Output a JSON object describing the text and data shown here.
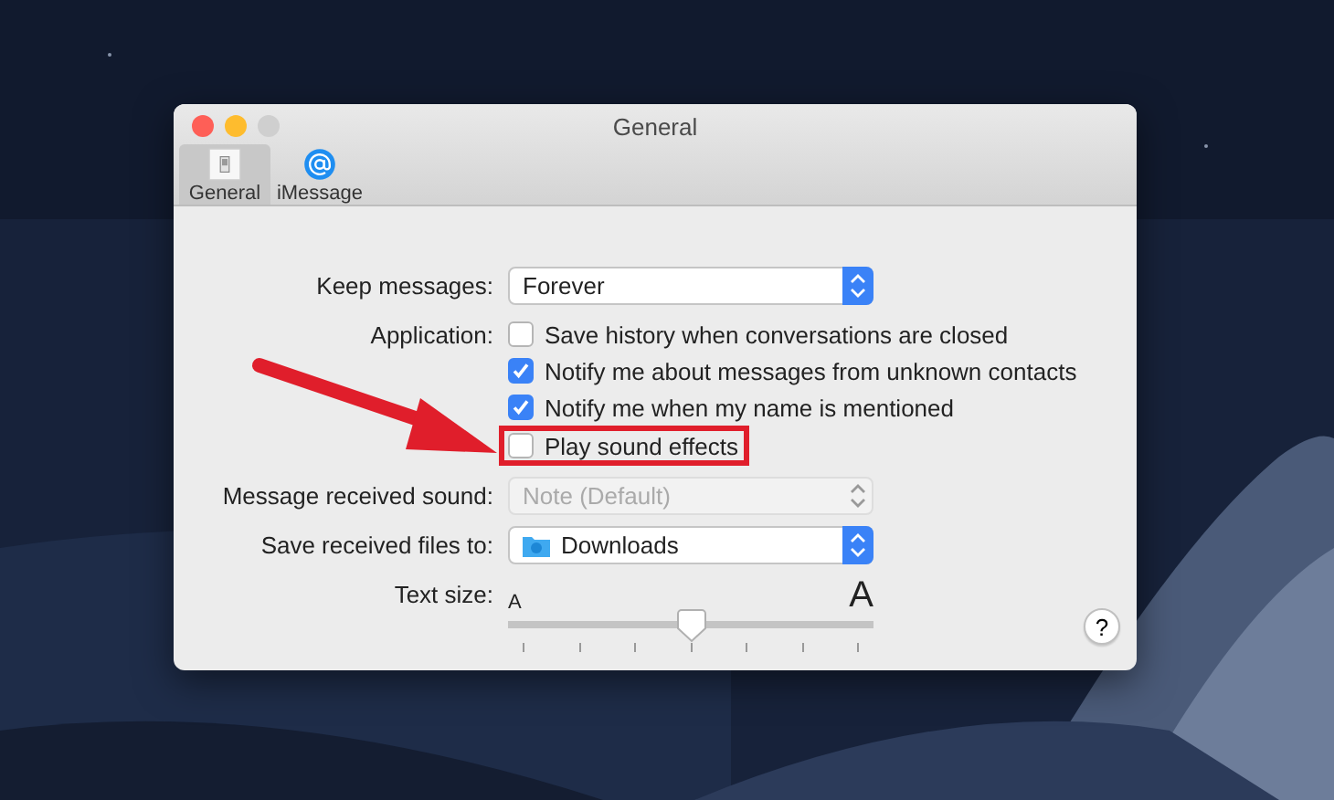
{
  "window": {
    "title": "General"
  },
  "tabs": [
    {
      "label": "General",
      "selected": true,
      "kind": "general"
    },
    {
      "label": "iMessage",
      "selected": false,
      "kind": "imessage"
    }
  ],
  "settings": [
    {
      "kind": "select",
      "label": "Keep messages:",
      "value": "Forever",
      "disabled": false
    },
    {
      "kind": "checkboxes",
      "label": "Application:",
      "options": [
        {
          "label": "Save history when conversations are closed",
          "checked": false,
          "highlighted": false
        },
        {
          "label": "Notify me about messages from unknown contacts",
          "checked": true,
          "highlighted": false
        },
        {
          "label": "Notify me when my name is mentioned",
          "checked": true,
          "highlighted": false
        },
        {
          "label": "Play sound effects",
          "checked": false,
          "highlighted": true
        }
      ]
    },
    {
      "kind": "select",
      "label": "Message received sound:",
      "value": "Note (Default)",
      "disabled": true
    },
    {
      "kind": "folder",
      "label": "Save received files to:",
      "value": "Downloads"
    },
    {
      "kind": "slider",
      "label": "Text size:",
      "min_label": "A",
      "max_label": "A",
      "level": 0.5
    }
  ],
  "help": {
    "label": "?"
  }
}
